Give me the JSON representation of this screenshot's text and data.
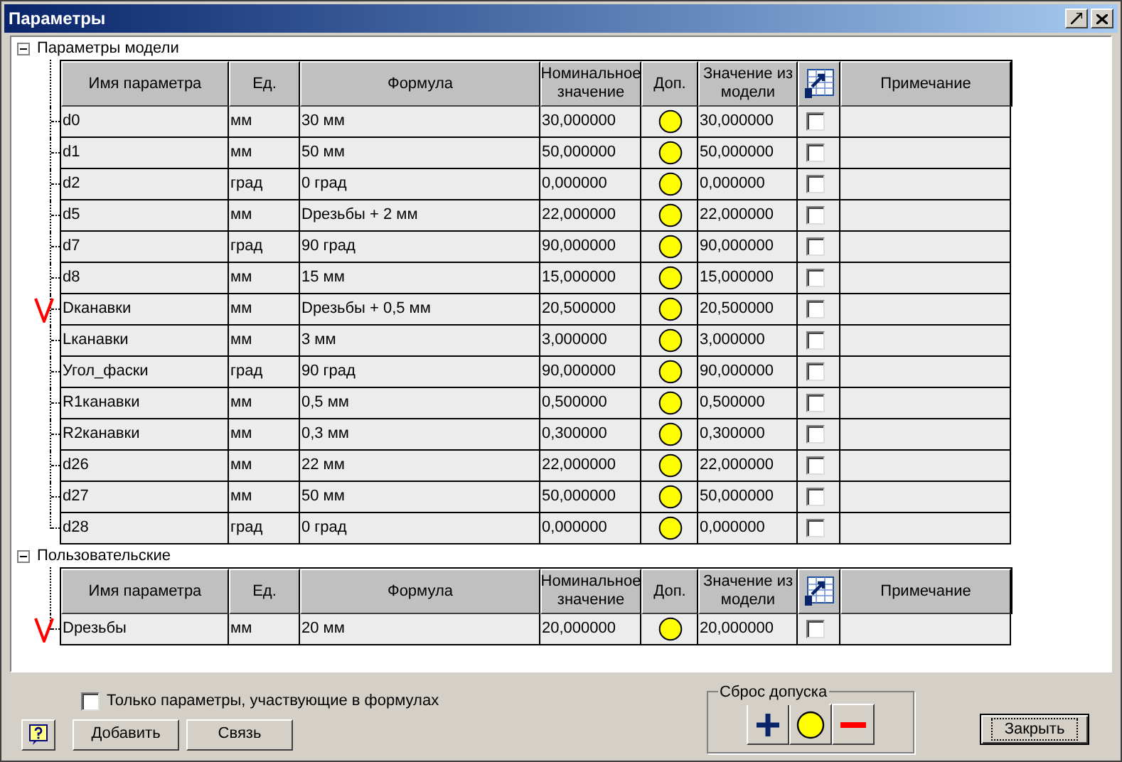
{
  "window": {
    "title": "Параметры"
  },
  "groups": [
    {
      "label": "Параметры модели",
      "expanded": true,
      "columns": [
        {
          "kind": "text",
          "label": "Имя параметра"
        },
        {
          "kind": "text",
          "label": "Ед."
        },
        {
          "kind": "text",
          "label": "Формула"
        },
        {
          "kind": "text",
          "label": "Номинальное значение"
        },
        {
          "kind": "text",
          "label": "Доп."
        },
        {
          "kind": "text",
          "label": "Значение из модели"
        },
        {
          "kind": "icon"
        },
        {
          "kind": "text",
          "label": "Примечание"
        }
      ],
      "rows": [
        {
          "name": "d0",
          "unit": "мм",
          "formula": "30 мм",
          "nominal": "30,000000",
          "model_value": "30,000000",
          "checked": false,
          "marked": false
        },
        {
          "name": "d1",
          "unit": "мм",
          "formula": "50 мм",
          "nominal": "50,000000",
          "model_value": "50,000000",
          "checked": false,
          "marked": false
        },
        {
          "name": "d2",
          "unit": "град",
          "formula": "0 град",
          "nominal": "0,000000",
          "model_value": "0,000000",
          "checked": false,
          "marked": false
        },
        {
          "name": "d5",
          "unit": "мм",
          "formula": "Dрезьбы + 2 мм",
          "nominal": "22,000000",
          "model_value": "22,000000",
          "checked": false,
          "marked": false
        },
        {
          "name": "d7",
          "unit": "град",
          "formula": "90 град",
          "nominal": "90,000000",
          "model_value": "90,000000",
          "checked": false,
          "marked": false
        },
        {
          "name": "d8",
          "unit": "мм",
          "formula": "15 мм",
          "nominal": "15,000000",
          "model_value": "15,000000",
          "checked": false,
          "marked": false
        },
        {
          "name": "Dканавки",
          "unit": "мм",
          "formula": "Dрезьбы + 0,5 мм",
          "nominal": "20,500000",
          "model_value": "20,500000",
          "checked": false,
          "marked": true
        },
        {
          "name": "Lканавки",
          "unit": "мм",
          "formula": "3 мм",
          "nominal": "3,000000",
          "model_value": "3,000000",
          "checked": false,
          "marked": false
        },
        {
          "name": "Угол_фаски",
          "unit": "град",
          "formula": "90 град",
          "nominal": "90,000000",
          "model_value": "90,000000",
          "checked": false,
          "marked": false
        },
        {
          "name": "R1канавки",
          "unit": "мм",
          "formula": "0,5 мм",
          "nominal": "0,500000",
          "model_value": "0,500000",
          "checked": false,
          "marked": false
        },
        {
          "name": "R2канавки",
          "unit": "мм",
          "formula": "0,3 мм",
          "nominal": "0,300000",
          "model_value": "0,300000",
          "checked": false,
          "marked": false
        },
        {
          "name": "d26",
          "unit": "мм",
          "formula": "22 мм",
          "nominal": "22,000000",
          "model_value": "22,000000",
          "checked": false,
          "marked": false
        },
        {
          "name": "d27",
          "unit": "мм",
          "formula": "50 мм",
          "nominal": "50,000000",
          "model_value": "50,000000",
          "checked": false,
          "marked": false
        },
        {
          "name": "d28",
          "unit": "град",
          "formula": "0 град",
          "nominal": "0,000000",
          "model_value": "0,000000",
          "checked": false,
          "marked": false
        }
      ]
    },
    {
      "label": "Пользовательские",
      "expanded": true,
      "columns": [
        {
          "kind": "text",
          "label": "Имя параметра"
        },
        {
          "kind": "text",
          "label": "Ед."
        },
        {
          "kind": "text",
          "label": "Формула"
        },
        {
          "kind": "text",
          "label": "Номинальное значение"
        },
        {
          "kind": "text",
          "label": "Доп."
        },
        {
          "kind": "text",
          "label": "Значение из модели"
        },
        {
          "kind": "icon"
        },
        {
          "kind": "text",
          "label": "Примечание"
        }
      ],
      "rows": [
        {
          "name": "Dрезьбы",
          "unit": "мм",
          "formula": "20 мм",
          "nominal": "20,000000",
          "model_value": "20,000000",
          "checked": false,
          "marked": true
        }
      ]
    }
  ],
  "filter": {
    "label": "Только параметры, участвующие в формулах",
    "checked": false
  },
  "buttons": [
    "Добавить",
    "Связь"
  ],
  "tolerance_reset": {
    "label": "Сброс допуска"
  },
  "close_button": "Закрыть"
}
